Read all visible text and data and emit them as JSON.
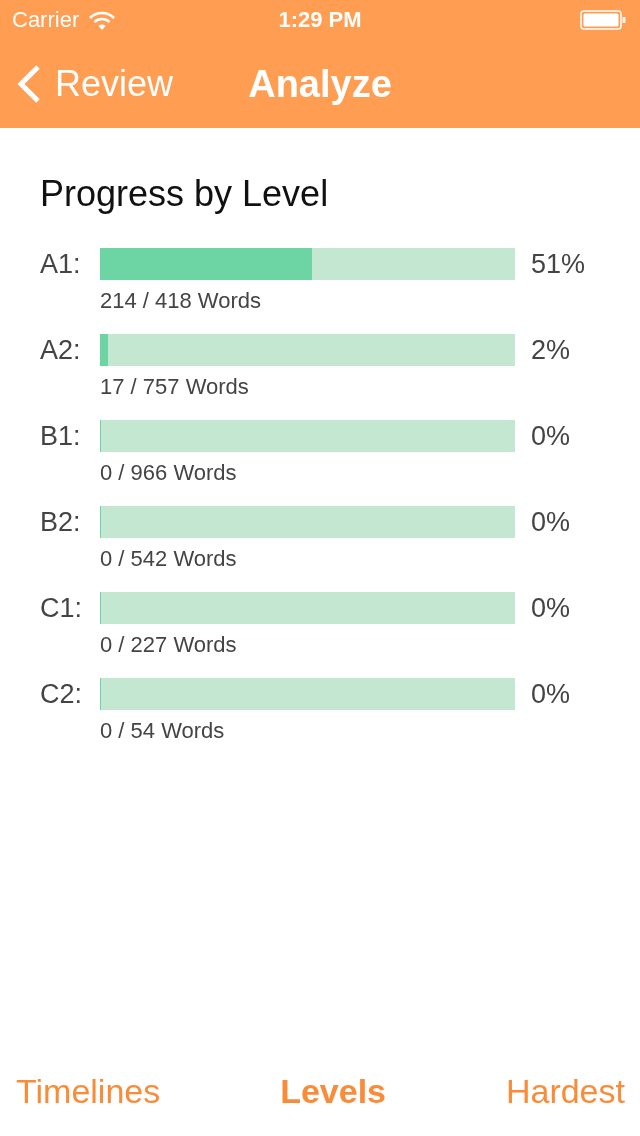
{
  "status_bar": {
    "carrier": "Carrier",
    "time": "1:29 PM"
  },
  "nav_bar": {
    "back_label": "Review",
    "title": "Analyze"
  },
  "section_title": "Progress by Level",
  "levels": [
    {
      "label": "A1:",
      "level": 0.51,
      "percent": "51%",
      "count": "214 / 418 Words"
    },
    {
      "label": "A2:",
      "level": 0.02,
      "percent": "2%",
      "count": "17 / 757 Words"
    },
    {
      "label": "B1:",
      "level": 0,
      "percent": "0%",
      "count": "0 / 966 Words"
    },
    {
      "label": "B2:",
      "level": 0,
      "percent": "0%",
      "count": "0 / 542 Words"
    },
    {
      "label": "C1:",
      "level": 0,
      "percent": "0%",
      "count": "0 / 227 Words"
    },
    {
      "label": "C2:",
      "level": 0,
      "percent": "0%",
      "count": "0 / 54 Words"
    }
  ],
  "tabs": [
    {
      "label": "Timelines",
      "selected": false
    },
    {
      "label": "Levels",
      "selected": true
    },
    {
      "label": "Hardest",
      "selected": false
    }
  ]
}
